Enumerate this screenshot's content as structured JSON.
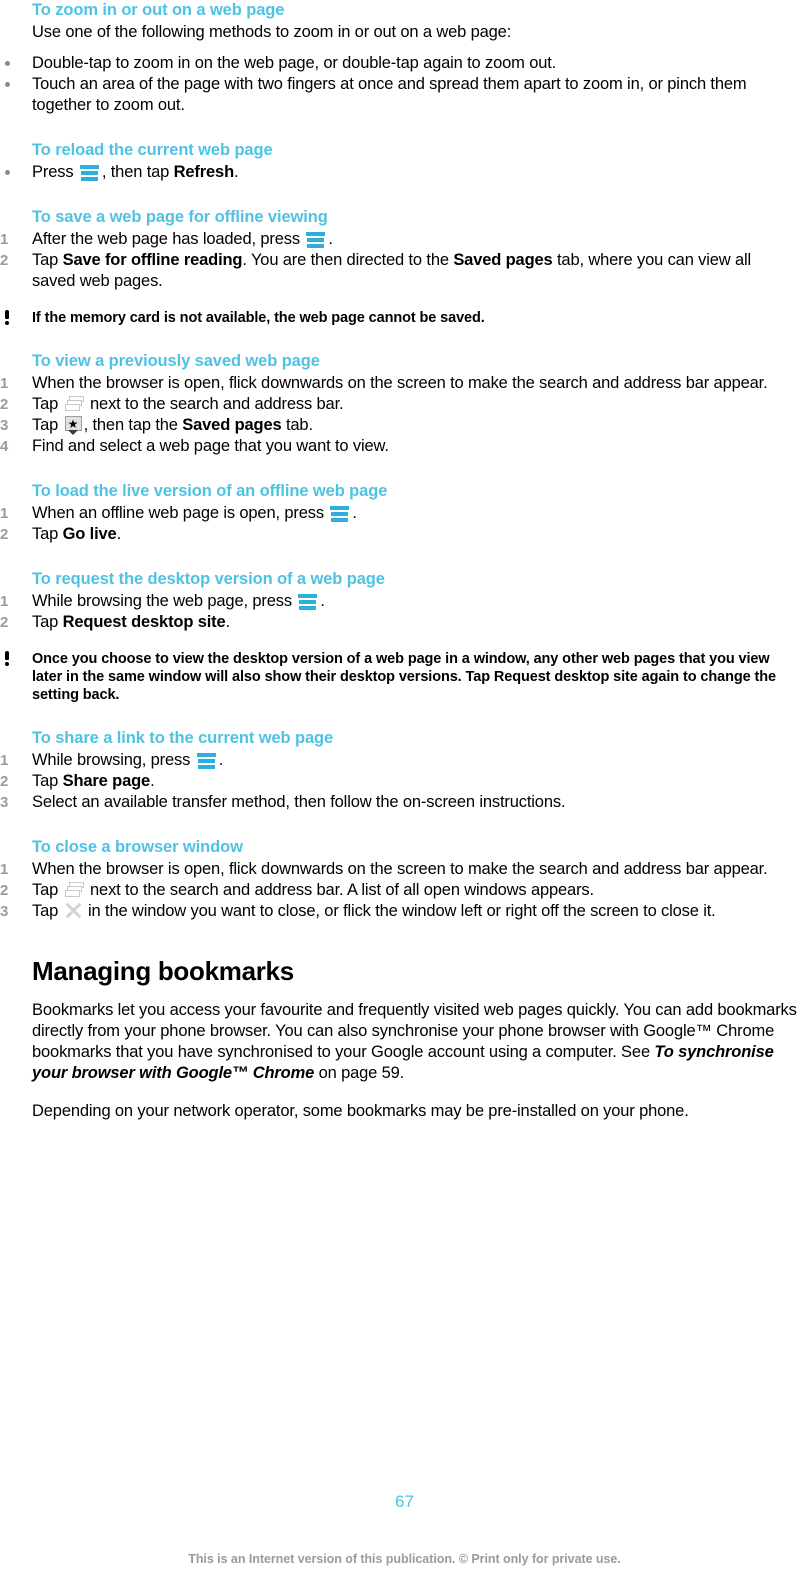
{
  "document": {
    "page_number": "67",
    "footer_note": "This is an Internet version of this publication. © Print only for private use.",
    "accent_color": "#4FC2E4",
    "icon_color": "#2BAFDC"
  },
  "sections": [
    {
      "heading": "To zoom in or out on a web page",
      "intro": "Use one of the following methods to zoom in or out on a web page:",
      "bullets": [
        "Double-tap to zoom in on the web page, or double-tap again to zoom out.",
        "Touch an area of the page with two fingers at once and spread them apart to zoom in, or pinch them together to zoom out."
      ]
    },
    {
      "heading": "To reload the current web page",
      "bullet_press_prefix": "Press",
      "bullet_press_middle": ", then tap",
      "bullet_press_bold": "Refresh",
      "bullet_press_suffix": "."
    },
    {
      "heading": "To save a web page for offline viewing",
      "step1_prefix": "After the web page has loaded, press",
      "step1_suffix": ".",
      "step2_prefix": "Tap",
      "step2_bold1": "Save for offline reading",
      "step2_middle": ". You are then directed to the",
      "step2_bold2": "Saved pages",
      "step2_suffix": "tab, where you can view all saved web pages.",
      "note": "If the memory card is not available, the web page cannot be saved."
    },
    {
      "heading": "To view a previously saved web page",
      "step1": "When the browser is open, flick downwards on the screen to make the search and address bar appear.",
      "step2_prefix": "Tap",
      "step2_suffix": "next to the search and address bar.",
      "step3_prefix": "Tap",
      "step3_middle": ", then tap the",
      "step3_bold": "Saved pages",
      "step3_suffix": "tab.",
      "step4": "Find and select a web page that you want to view."
    },
    {
      "heading": "To load the live version of an offline web page",
      "step1_prefix": "When an offline web page is open, press",
      "step1_suffix": ".",
      "step2_prefix": "Tap",
      "step2_bold": "Go live",
      "step2_suffix": "."
    },
    {
      "heading": "To request the desktop version of a web page",
      "step1_prefix": "While browsing the web page, press",
      "step1_suffix": ".",
      "step2_prefix": "Tap",
      "step2_bold": "Request desktop site",
      "step2_suffix": ".",
      "note_part1": "Once you choose to view the desktop version of a web page in a window, any other web pages that you view later in the same window will also show their desktop versions. Tap",
      "note_bold": "Request desktop site",
      "note_part2": "again to change the setting back."
    },
    {
      "heading": "To share a link to the current web page",
      "step1_prefix": "While browsing, press",
      "step1_suffix": ".",
      "step2_prefix": "Tap",
      "step2_bold": "Share page",
      "step2_suffix": ".",
      "step3": "Select an available transfer method, then follow the on-screen instructions."
    },
    {
      "heading": "To close a browser window",
      "step1": "When the browser is open, flick downwards on the screen to make the search and address bar appear.",
      "step2_prefix": "Tap",
      "step2_suffix": "next to the search and address bar. A list of all open windows appears.",
      "step3_prefix": "Tap",
      "step3_suffix": "in the window you want to close, or flick the window left or right off the screen to close it."
    }
  ],
  "managing_bookmarks": {
    "heading": "Managing bookmarks",
    "para1_part1": "Bookmarks let you access your favourite and frequently visited web pages quickly. You can add bookmarks directly from your phone browser. You can also synchronise your phone browser with Google™ Chrome bookmarks that you have synchronised to your Google account using a computer. See",
    "para1_italic": "To synchronise your browser with Google™ Chrome",
    "para1_part2": "on page 59.",
    "para2": "Depending on your network operator, some bookmarks may be pre-installed on your phone."
  }
}
